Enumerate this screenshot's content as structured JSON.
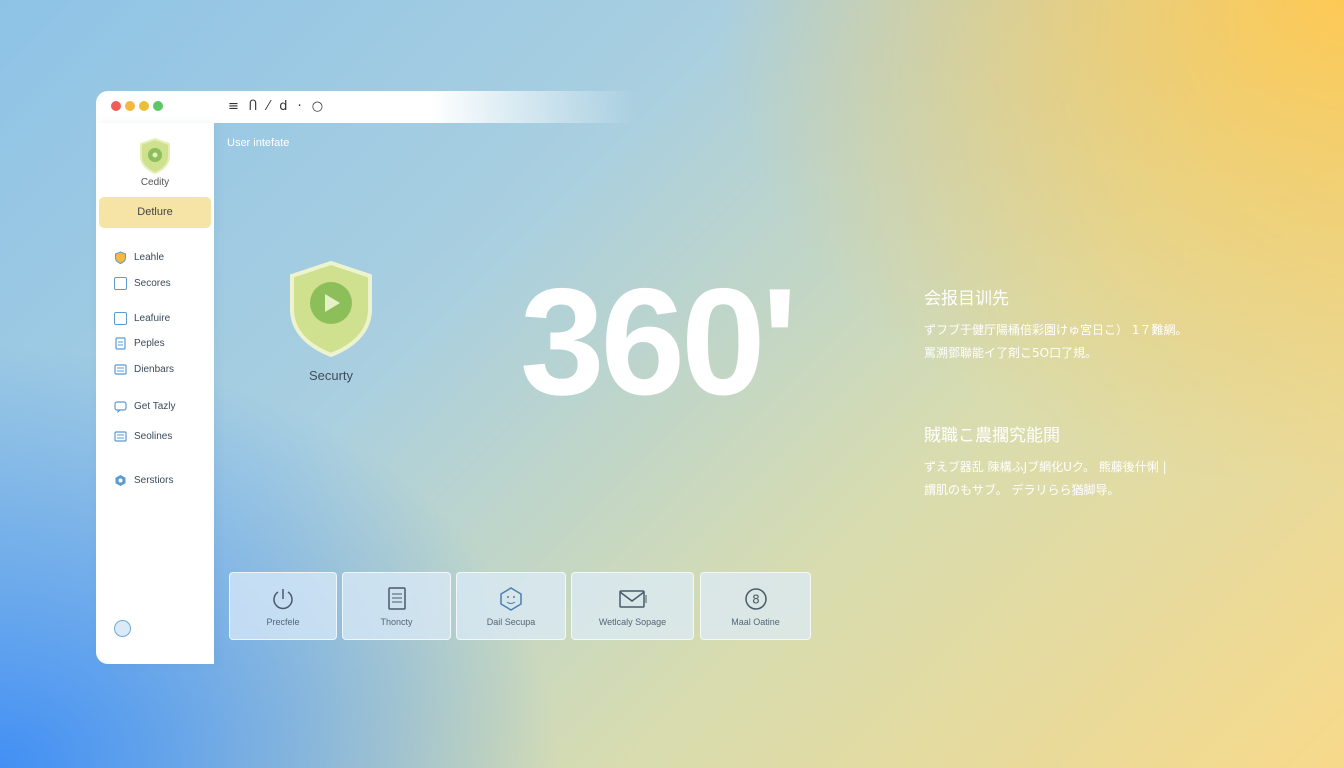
{
  "window": {
    "toolbar": [
      {
        "icon": "menu-icon",
        "glyph": "≡"
      },
      {
        "icon": "a-icon",
        "glyph": "Ⴖ"
      },
      {
        "icon": "pen-icon",
        "glyph": "⁄"
      },
      {
        "icon": "d-icon",
        "glyph": "d"
      },
      {
        "icon": "dot-icon",
        "glyph": "·"
      },
      {
        "icon": "circle-icon",
        "glyph": "○"
      }
    ]
  },
  "sidebar": {
    "brand_label": "Cedity",
    "active_item": "Detlure",
    "items": [
      {
        "label": "Leahle",
        "icon": "shield-icon"
      },
      {
        "label": "Secores",
        "icon": "box-icon"
      },
      {
        "label": "Leafuire",
        "icon": "box-icon"
      },
      {
        "label": "Peples",
        "icon": "page-icon"
      },
      {
        "label": "Dienbars",
        "icon": "list-icon"
      },
      {
        "label": "Get Tazly",
        "icon": "chat-icon"
      },
      {
        "label": "Seolines",
        "icon": "list-icon"
      },
      {
        "label": "Serstiors",
        "icon": "hex-icon"
      }
    ]
  },
  "main": {
    "heading": "User intefate",
    "shield_label": "Securty",
    "big_number": "360'",
    "info": [
      {
        "title": "会报目训先",
        "lines": [
          "ずフブ于健厅陽桶倍彩園けゅ宮日こ） 1７難網。",
          "罵溯鄧聯能イ了剤こ5O口了規。"
        ]
      },
      {
        "title": "賊職こ農擱究能閧",
        "lines": [
          "ずえブ器乱 陳構ふJブ網化Uク。 熊藤後什悧 |",
          "謂肌のもサブ。 デラリらら猶脚导。"
        ]
      }
    ],
    "tiles": [
      {
        "label": "Precfele",
        "icon": "power-icon"
      },
      {
        "label": "Thoncty",
        "icon": "document-icon"
      },
      {
        "label": "Dail Secupa",
        "icon": "face-icon"
      },
      {
        "label": "Wetlcaly Sopage",
        "icon": "mail-icon"
      },
      {
        "label": "Maal Oatine",
        "icon": "circle-s-icon"
      }
    ]
  },
  "colors": {
    "active_item_bg": "#f6e4a6",
    "shield_fill": "#cfe08e",
    "shield_inner": "#8cbf5a",
    "accent_blue": "#5b9bd0"
  }
}
